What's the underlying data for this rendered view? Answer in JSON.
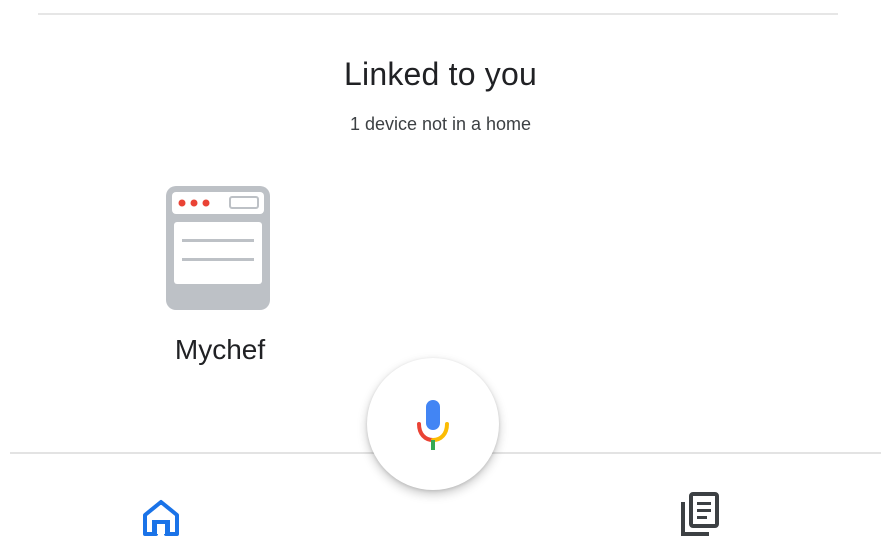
{
  "linked": {
    "title": "Linked to you",
    "subtitle": "1 device not in a home"
  },
  "devices": [
    {
      "label": "Mychef",
      "icon": "oven-icon"
    }
  ],
  "assistant": {
    "icon": "mic-icon"
  },
  "bottom_nav": [
    {
      "name": "home",
      "icon": "home-icon",
      "active": true
    },
    {
      "name": "feed",
      "icon": "feed-icon",
      "active": false
    }
  ],
  "colors": {
    "accent_blue": "#1a73e8",
    "red": "#ea4335",
    "yellow": "#fbbc04",
    "green": "#34a853",
    "icon_gray": "#bdc1c6",
    "text_dark": "#202124"
  }
}
